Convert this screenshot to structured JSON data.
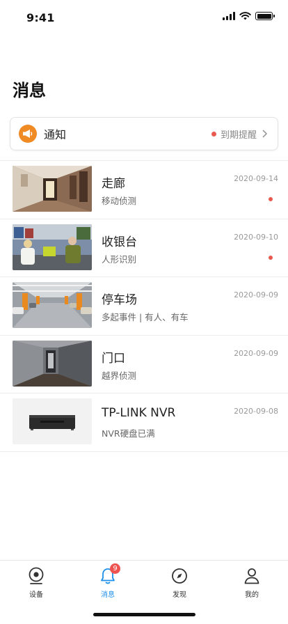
{
  "status_bar": {
    "time": "9:41"
  },
  "page": {
    "title": "消息"
  },
  "notice": {
    "label": "通知",
    "reminder": "到期提醒"
  },
  "messages": [
    {
      "title": "走廊",
      "subtitle": "移动侦测",
      "date": "2020-09-14",
      "unread": true,
      "thumbnail": "hallway"
    },
    {
      "title": "收银台",
      "subtitle": "人形识别",
      "date": "2020-09-10",
      "unread": true,
      "thumbnail": "cashier"
    },
    {
      "title": "停车场",
      "subtitle": "多起事件 | 有人、有车",
      "date": "2020-09-09",
      "unread": false,
      "thumbnail": "parking"
    },
    {
      "title": "门口",
      "subtitle": "越界侦测",
      "date": "2020-09-09",
      "unread": false,
      "thumbnail": "doorway"
    },
    {
      "title": "TP-LINK NVR",
      "subtitle": "NVR硬盘已满",
      "date": "2020-09-08",
      "unread": false,
      "thumbnail": "nvr-device"
    }
  ],
  "tab_bar": {
    "tabs": [
      {
        "label": "设备",
        "icon": "camera-icon",
        "active": false
      },
      {
        "label": "消息",
        "icon": "bell-icon",
        "active": true,
        "badge": "9"
      },
      {
        "label": "发现",
        "icon": "compass-icon",
        "active": false
      },
      {
        "label": "我的",
        "icon": "person-icon",
        "active": false
      }
    ]
  },
  "colors": {
    "accent": "#1e8fea",
    "badge": "#ef5350",
    "unread_dot": "#e85a4f",
    "notice_icon": "#f08a24"
  }
}
